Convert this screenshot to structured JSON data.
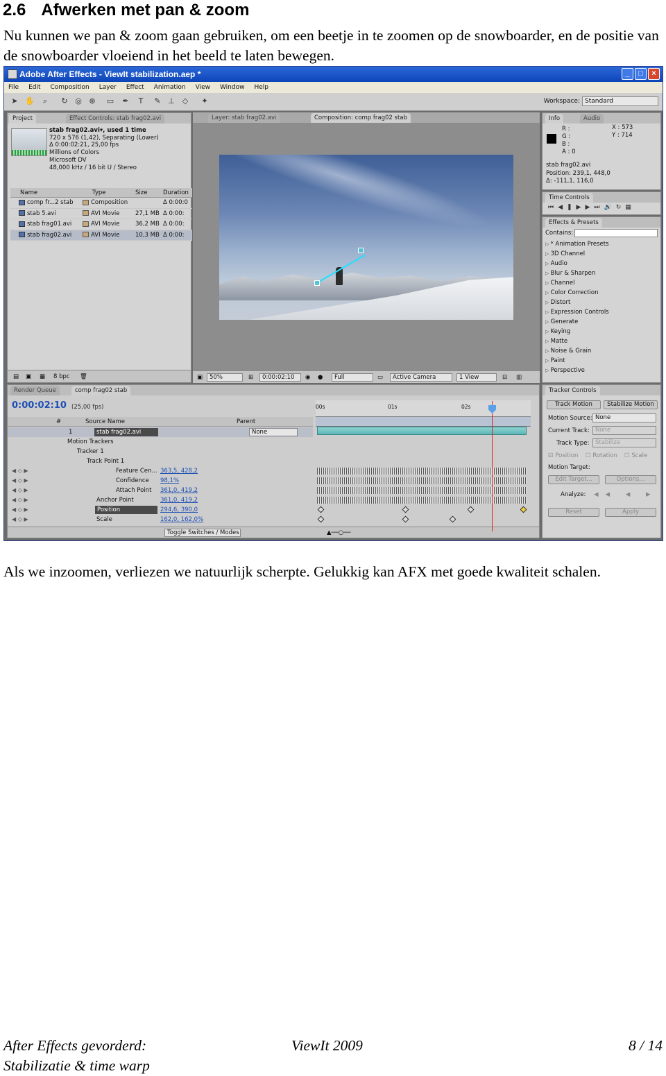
{
  "heading": {
    "number": "2.6",
    "title": "Afwerken met pan & zoom"
  },
  "intro": "Nu kunnen we pan & zoom gaan gebruiken, om een beetje in te zoomen op de snowboarder, en de positie van de snowboarder vloeiend in het beeld te laten bewegen.",
  "screenshot": {
    "window_title": "Adobe After Effects - ViewIt stabilization.aep *",
    "menu": [
      "File",
      "Edit",
      "Composition",
      "Layer",
      "Effect",
      "Animation",
      "View",
      "Window",
      "Help"
    ],
    "workspace_label": "Workspace:",
    "workspace_value": "Standard",
    "project": {
      "tabs": [
        "Project",
        "Effect Controls: stab frag02.avi"
      ],
      "info_lines": [
        "stab frag02.avi▾, used 1 time",
        "720 x 576 (1,42), Separating (Lower)",
        "Δ 0:00:02:21, 25,00 fps",
        "Millions of Colors",
        "Microsoft DV",
        "48,000 kHz / 16 bit U / Stereo"
      ],
      "columns": [
        "Name",
        "Type",
        "Size",
        "Duration"
      ],
      "rows": [
        {
          "name": "comp fr...2 stab",
          "type": "Composition",
          "size": "",
          "duration": "Δ 0:00:0"
        },
        {
          "name": "stab 5.avi",
          "type": "AVI Movie",
          "size": "27,1 MB",
          "duration": "Δ 0:00:"
        },
        {
          "name": "stab frag01.avi",
          "type": "AVI Movie",
          "size": "36,2 MB",
          "duration": "Δ 0:00:"
        },
        {
          "name": "stab frag02.avi",
          "type": "AVI Movie",
          "size": "10,3 MB",
          "duration": "Δ 0:00:"
        }
      ],
      "bpc": "8 bpc"
    },
    "viewer": {
      "tabs": [
        "Layer: stab frag02.avi",
        "Composition: comp frag02 stab"
      ],
      "zoom": "50%",
      "timecode": "0:00:02:10",
      "resolution": "Full",
      "camera": "Active Camera",
      "view": "1 View"
    },
    "info": {
      "tabs": [
        "Info",
        "Audio"
      ],
      "rgba": [
        "R :",
        "G :",
        "B :",
        "A : 0"
      ],
      "xy": [
        "X : 573",
        "Y : 714"
      ],
      "clip_lines": [
        "stab frag02.avi",
        "Position: 239,1, 448,0",
        "Δ: -111,1, 116,0"
      ]
    },
    "time_controls_tab": "Time Controls",
    "effects": {
      "tab": "Effects & Presets",
      "contains_label": "Contains:",
      "items": [
        "* Animation Presets",
        "3D Channel",
        "Audio",
        "Blur & Sharpen",
        "Channel",
        "Color Correction",
        "Distort",
        "Expression Controls",
        "Generate",
        "Keying",
        "Matte",
        "Noise & Grain",
        "Paint",
        "Perspective"
      ]
    },
    "timeline": {
      "tabs": [
        "Render Queue",
        "comp frag02 stab"
      ],
      "time": "0:00:02:10",
      "fps": "(25,00 fps)",
      "col_source": "Source Name",
      "col_parent": "Parent",
      "col_num": "#",
      "ruler": [
        "00s",
        "01s",
        "02s"
      ],
      "layer_num": "1",
      "layer_name": "stab frag02.avi",
      "parent_value": "None",
      "rows": [
        {
          "label": "Motion Trackers",
          "value": ""
        },
        {
          "label": "Tracker 1",
          "value": ""
        },
        {
          "label": "Track Point 1",
          "value": ""
        },
        {
          "label": "Feature Cen...",
          "value": "363,5, 428,2"
        },
        {
          "label": "Confidence",
          "value": "98,1%"
        },
        {
          "label": "Attach Point",
          "value": "361,0, 419,2"
        },
        {
          "label": "Anchor Point",
          "value": "361,0, 419,2"
        },
        {
          "label": "Position",
          "value": "294,6, 390,0"
        },
        {
          "label": "Scale",
          "value": "162,0, 162,0%"
        }
      ],
      "toggle_label": "Toggle Switches / Modes"
    },
    "tracker": {
      "tab": "Tracker Controls",
      "track_motion": "Track Motion",
      "stabilize_motion": "Stabilize Motion",
      "motion_source_label": "Motion Source:",
      "motion_source_value": "None",
      "current_track_label": "Current Track:",
      "current_track_value": "None",
      "track_type_label": "Track Type:",
      "track_type_value": "Stabilize",
      "checks": [
        "Position",
        "Rotation",
        "Scale"
      ],
      "motion_target_label": "Motion Target:",
      "edit_target": "Edit Target...",
      "options": "Options...",
      "analyze_label": "Analyze:",
      "reset": "Reset",
      "apply": "Apply"
    }
  },
  "outro": "Als we inzoomen, verliezen we natuurlijk scherpte.  Gelukkig kan AFX met goede kwaliteit schalen.",
  "footer": {
    "left_line1": "After Effects gevorderd:",
    "left_line2": "Stabilizatie & time warp",
    "center": "ViewIt 2009",
    "right": "8 / 14"
  }
}
